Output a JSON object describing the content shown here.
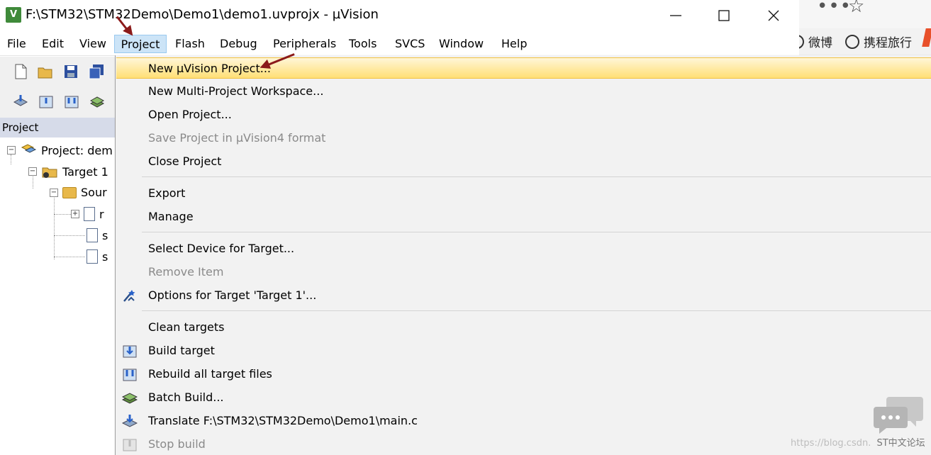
{
  "window": {
    "title": "F:\\STM32\\STM32Demo\\Demo1\\demo1.uvprojx - µVision",
    "app_icon_text": "V"
  },
  "menubar": {
    "items": [
      "File",
      "Edit",
      "View",
      "Project",
      "Flash",
      "Debug",
      "Peripherals",
      "Tools",
      "SVCS",
      "Window",
      "Help"
    ],
    "active": "Project"
  },
  "panel": {
    "title": "Project",
    "tree": {
      "project": "Project: dem",
      "target": "Target 1",
      "group": "Sour",
      "files": [
        "r",
        "s",
        "s"
      ]
    }
  },
  "project_menu": {
    "items": [
      {
        "label": "New µVision Project...",
        "state": "highlighted"
      },
      {
        "label": "New Multi-Project Workspace...",
        "state": "enabled"
      },
      {
        "label": "Open Project...",
        "state": "enabled"
      },
      {
        "label": "Save Project in µVision4 format",
        "state": "disabled"
      },
      {
        "label": "Close Project",
        "state": "enabled"
      },
      {
        "label": "Export",
        "state": "enabled"
      },
      {
        "label": "Manage",
        "state": "enabled"
      },
      {
        "label": "Select Device for Target...",
        "state": "enabled"
      },
      {
        "label": "Remove Item",
        "state": "disabled"
      },
      {
        "label": "Options for Target 'Target 1'...",
        "state": "enabled",
        "icon": "options-wand-icon"
      },
      {
        "label": "Clean targets",
        "state": "enabled"
      },
      {
        "label": "Build target",
        "state": "enabled",
        "icon": "build-icon"
      },
      {
        "label": "Rebuild all target files",
        "state": "enabled",
        "icon": "rebuild-icon"
      },
      {
        "label": "Batch Build...",
        "state": "enabled",
        "icon": "batch-build-icon"
      },
      {
        "label": "Translate F:\\STM32\\STM32Demo\\Demo1\\main.c",
        "state": "enabled",
        "icon": "translate-icon"
      },
      {
        "label": "Stop build",
        "state": "disabled",
        "icon": "stop-build-icon"
      }
    ]
  },
  "browser": {
    "link_weibo": "微博",
    "link_travel": "携程旅行"
  },
  "watermark": {
    "url": "https://blog.csdn.",
    "forum": "ST中文论坛"
  },
  "colors": {
    "highlight": "#ffdf75",
    "menu_bg": "#f2f2f2",
    "active_menu": "#cce4f7",
    "arrow": "#8b1a1a"
  }
}
